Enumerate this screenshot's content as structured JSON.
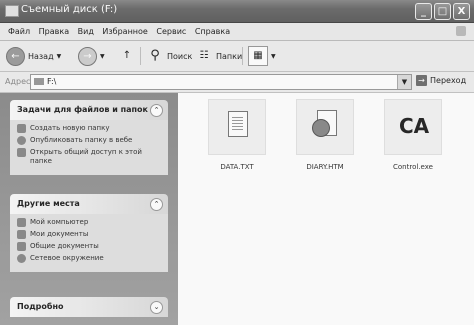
{
  "window": {
    "title": "Съемный диск (F:)",
    "buttons": [
      "_",
      "□",
      "X"
    ]
  },
  "menu": [
    "Файл",
    "Правка",
    "Вид",
    "Избранное",
    "Сервис",
    "Справка"
  ],
  "toolbar": {
    "back_label": "Назад",
    "search_label": "Поиск",
    "folders_label": "Папки"
  },
  "address": {
    "label": "Адрес:",
    "value": "F:\\",
    "go_label": "Переход"
  },
  "panels": {
    "tasks": {
      "title": "Задачи для файлов и папок",
      "items": [
        "Создать новую папку",
        "Опубликовать папку в вебе",
        "Открыть общий доступ к этой папке"
      ]
    },
    "places": {
      "title": "Другие места",
      "items": [
        "Мой компьютер",
        "Мои документы",
        "Общие документы",
        "Сетевое окружение"
      ]
    },
    "details": {
      "title": "Подробно"
    }
  },
  "files": [
    {
      "name": "DATA.TXT",
      "icon": "text-file-icon"
    },
    {
      "name": "DIARY.HTM",
      "icon": "html-file-icon"
    },
    {
      "name": "Control.exe",
      "icon": "exe-file-icon"
    }
  ]
}
